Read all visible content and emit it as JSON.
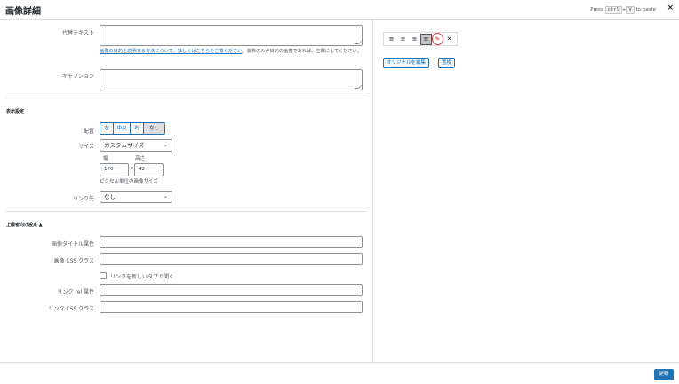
{
  "header": {
    "title": "画像詳細",
    "paste_prefix": "Press",
    "paste_key1": "ctrl",
    "paste_plus": "+",
    "paste_key2": "V",
    "paste_suffix": "to paste",
    "close_label": "×"
  },
  "fields": {
    "alt_label": "代替テキスト",
    "alt_help_link": "画像の目的を説明する方法について、詳しくはこちらをご覧ください",
    "alt_help_rest": "。装飾のみが目的の画像であれば、空欄にしてください。",
    "caption_label": "キャプション"
  },
  "display": {
    "heading": "表示設定",
    "align_label": "配置",
    "align_options": [
      "左",
      "中央",
      "右",
      "なし"
    ],
    "size_label": "サイズ",
    "size_value": "カスタムサイズ",
    "width_label": "幅",
    "height_label": "高さ",
    "width_value": "170",
    "height_value": "42",
    "times": "×",
    "pixel_note": "ピクセル単位の画像サイズ",
    "link_label": "リンク先",
    "link_value": "なし"
  },
  "advanced": {
    "heading": "上級者向け設定 ▲",
    "title_attr_label": "画像タイトル属性",
    "css_class_label": "画像 CSS クラス",
    "new_tab_label": "リンクを新しいタブで開く",
    "link_rel_label": "リンク rel 属性",
    "link_css_label": "リンク CSS クラス"
  },
  "toolbar": {
    "icons": [
      "align-left-icon",
      "align-center-icon",
      "align-right-icon",
      "align-none-icon",
      "edit-pencil-icon",
      "remove-icon"
    ],
    "edit_original": "オリジナルを編集",
    "replace": "置換"
  },
  "footer": {
    "update_label": "更新"
  },
  "colors": {
    "accent": "#2271b1",
    "pencil_highlight": "#d63638"
  }
}
